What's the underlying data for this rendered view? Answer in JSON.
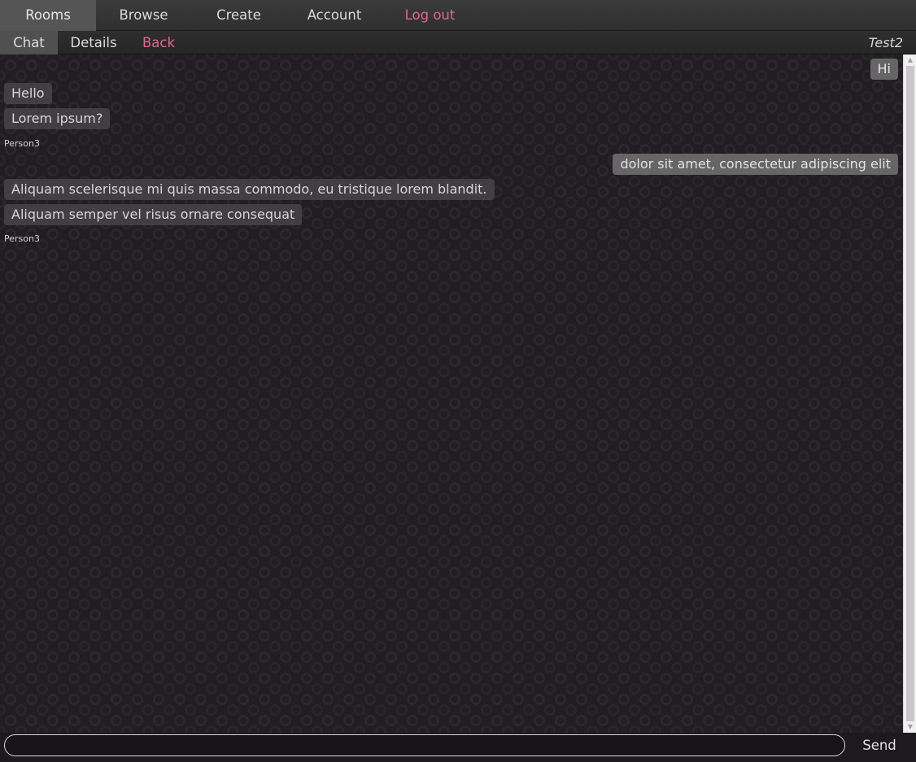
{
  "nav": {
    "items": [
      {
        "label": "Rooms"
      },
      {
        "label": "Browse"
      },
      {
        "label": "Create"
      },
      {
        "label": "Account"
      },
      {
        "label": "Log out"
      }
    ]
  },
  "subnav": {
    "items": [
      {
        "label": "Chat"
      },
      {
        "label": "Details"
      },
      {
        "label": "Back"
      }
    ],
    "room_title": "Test2"
  },
  "messages": [
    {
      "text": "Hi"
    },
    {
      "text": "Hello"
    },
    {
      "text": "Lorem ipsum?"
    },
    {
      "sender": "Person3"
    },
    {
      "text": "dolor sit amet, consectetur adipiscing elit"
    },
    {
      "text": "Aliquam scelerisque mi quis massa commodo, eu tristique lorem blandit."
    },
    {
      "text": "Aliquam semper vel risus ornare consequat"
    },
    {
      "sender": "Person3"
    }
  ],
  "composer": {
    "value": "",
    "placeholder": "",
    "send_label": "Send"
  },
  "colors": {
    "accent": "#e0668f",
    "background": "#221d22",
    "bubble": "#484648"
  },
  "icons": {
    "scroll_up": "scroll-up-arrow-icon",
    "scroll_down": "scroll-down-arrow-icon"
  }
}
